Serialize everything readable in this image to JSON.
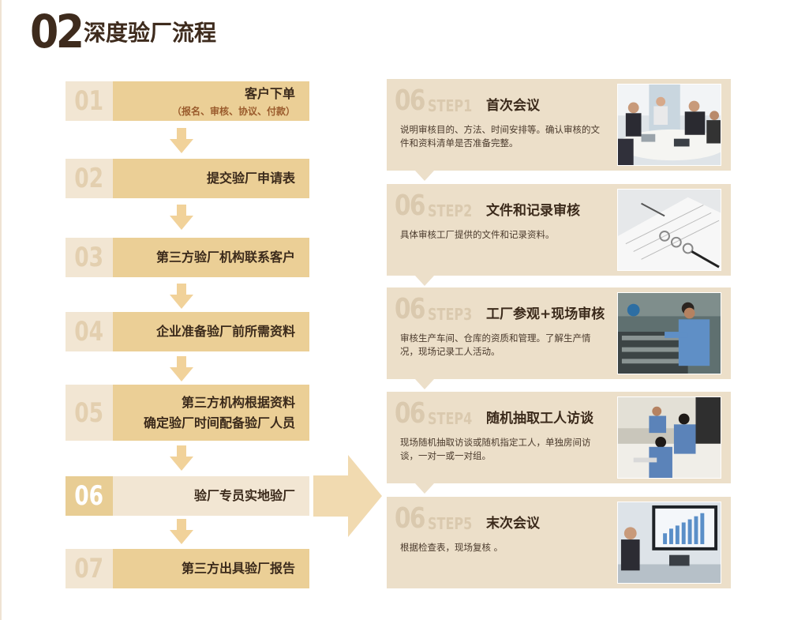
{
  "title": {
    "number": "02",
    "text": "深度验厂流程"
  },
  "left_steps": [
    {
      "num": "01",
      "title": "客户下单",
      "sub": "（报名、审核、协议、付款）"
    },
    {
      "num": "02",
      "title": "提交验厂申请表"
    },
    {
      "num": "03",
      "title": "第三方验厂机构联系客户"
    },
    {
      "num": "04",
      "title": "企业准备验厂前所需资料"
    },
    {
      "num": "05",
      "title": "第三方机构根据资料",
      "title2": "确定验厂时间配备验厂人员"
    },
    {
      "num": "06",
      "title": "验厂专员实地验厂"
    },
    {
      "num": "07",
      "title": "第三方出具验厂报告"
    }
  ],
  "right_steps": [
    {
      "prefix": "06",
      "step": "STEP1",
      "title": "首次会议",
      "desc": "说明审核目的、方法、时间安排等。确认审核的文件和资料清单是否准备完整。",
      "photo": "meeting-photo"
    },
    {
      "prefix": "06",
      "step": "STEP2",
      "title": "文件和记录审核",
      "desc": "具体审核工厂提供的文件和记录资料。",
      "photo": "documents-photo"
    },
    {
      "prefix": "06",
      "step": "STEP3",
      "title": "工厂参观+现场审核",
      "desc": "审核生产车间、仓库的资质和管理。了解生产情况，现场记录工人活动。",
      "photo": "factory-photo"
    },
    {
      "prefix": "06",
      "step": "STEP4",
      "title": "随机抽取工人访谈",
      "desc": "现场随机抽取访谈或随机指定工人，单独房间访谈，一对一或一对组。",
      "photo": "interview-photo"
    },
    {
      "prefix": "06",
      "step": "STEP5",
      "title": "末次会议",
      "desc": "根据检查表，现场复核 。",
      "photo": "closing-meeting-photo"
    }
  ],
  "colors": {
    "accent": "#ebcf96",
    "light": "#f2e6d3",
    "panel": "#ecdfc9",
    "dark_text": "#3b2a1b",
    "arrow": "#f1d29a"
  }
}
